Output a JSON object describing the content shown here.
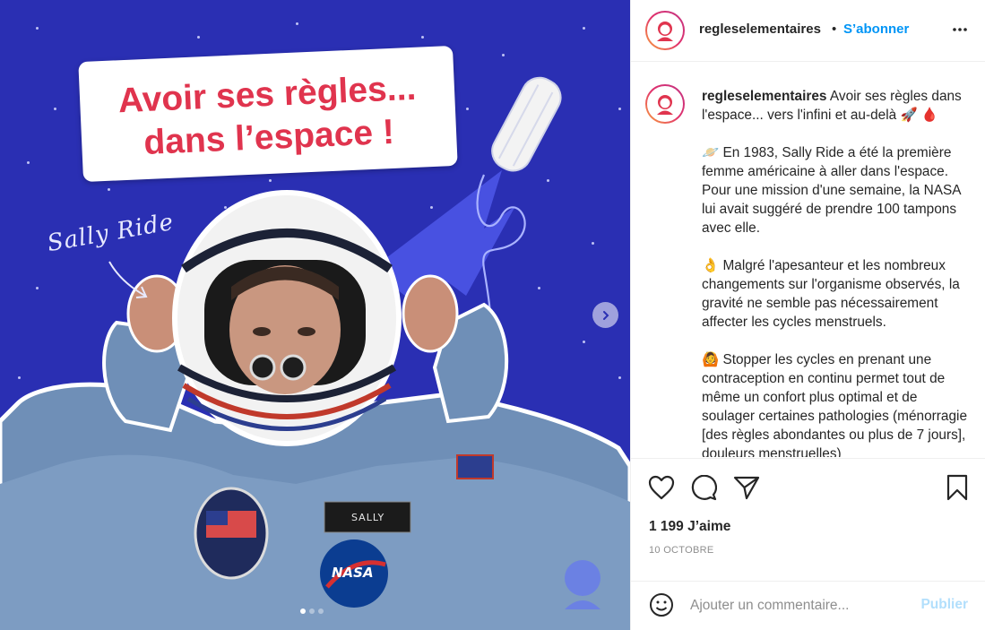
{
  "post": {
    "image": {
      "headline_line1": "Avoir ses règles...",
      "headline_line2": "dans l’espace !",
      "handwritten_label": "Sally Ride",
      "name_tag": "SALLY",
      "patch_text": "NASA",
      "background_color": "#2a2fb3",
      "headline_color": "#e0344e",
      "carousel": {
        "total": 3,
        "current": 1
      }
    },
    "header": {
      "username": "regleselementaires",
      "separator": "•",
      "follow_label": "S’abonner"
    },
    "caption": {
      "username": "regleselementaires",
      "intro": " Avoir ses règles dans l'espace... vers l'infini et au-delà 🚀 🩸",
      "paragraph1": "🪐 En 1983, Sally Ride a été la première femme américaine à aller dans l'espace. Pour une mission d'une semaine, la NASA lui avait suggéré de prendre 100 tampons avec elle.",
      "paragraph2": "👌 Malgré l'apesanteur et les nombreux changements sur l'organisme observés, la gravité ne semble pas nécessairement affecter les cycles menstruels.",
      "paragraph3": "🙆 Stopper les cycles en prenant une contraception en continu permet tout de même un confort plus optimal et de soulager certaines pathologies (ménorragie [des règles abondantes ou plus de 7 jours], douleurs menstruelles)"
    },
    "actions": {
      "likes": "1 199 J’aime",
      "date": "10 OCTOBRE"
    },
    "comment": {
      "placeholder": "Ajouter un commentaire...",
      "publish_label": "Publier"
    },
    "colors": {
      "link_blue": "#0095f6",
      "publish_disabled": "#b2dffc",
      "muted": "#8e8e8e"
    }
  }
}
